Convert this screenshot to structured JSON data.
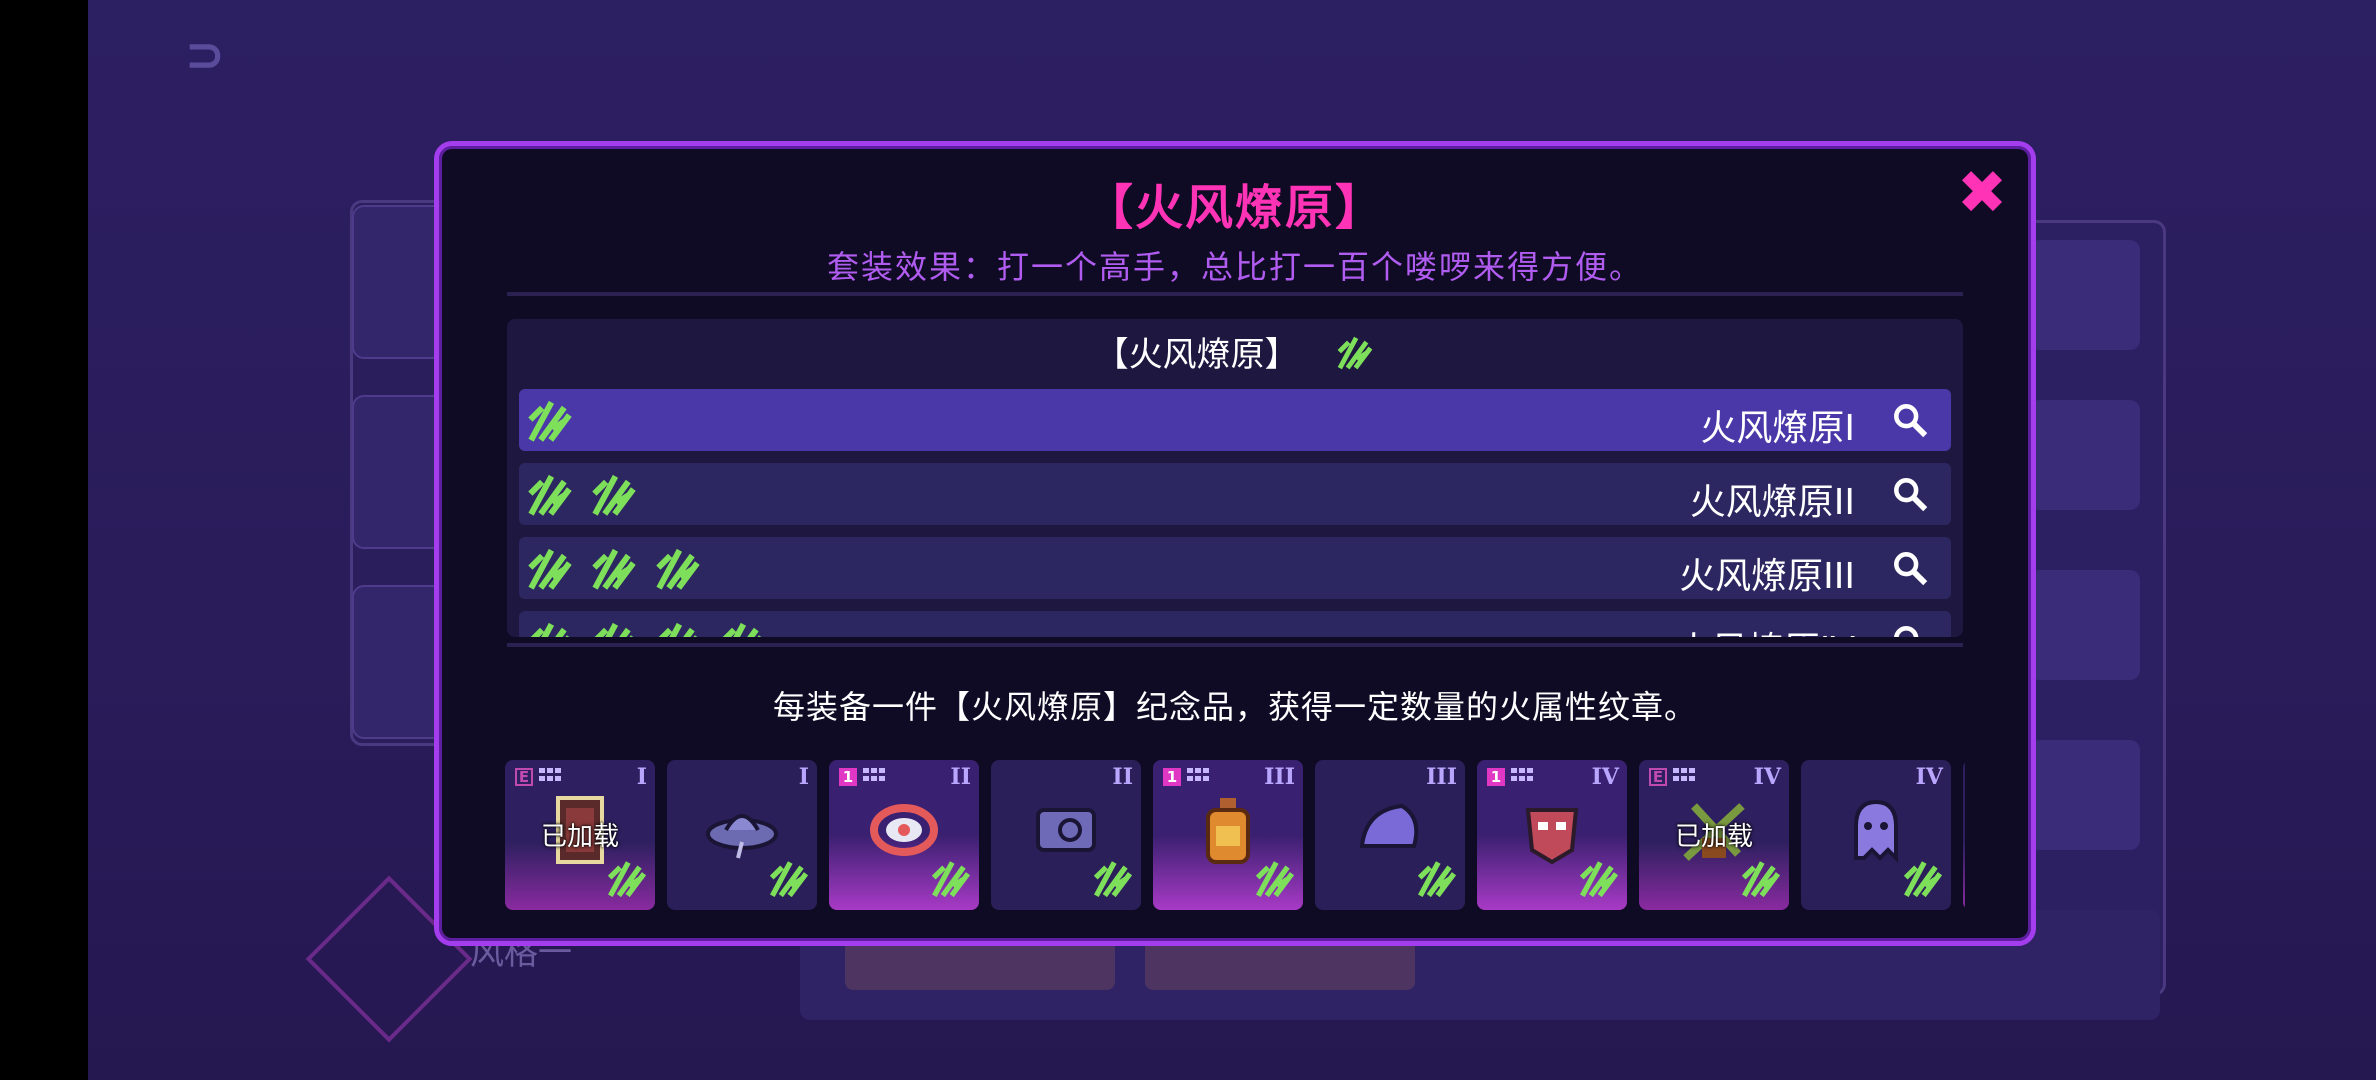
{
  "background": {
    "style_label": "风格一",
    "back_glyph": "⊃"
  },
  "modal": {
    "title": "【火风燎原】",
    "close_glyph": "✖",
    "set_effect": "套装效果：打一个高手，总比打一百个喽啰来得方便。",
    "list_header_title": "【火风燎原】",
    "tiers": [
      {
        "name": "火风燎原I",
        "icon_count": 1,
        "selected": true
      },
      {
        "name": "火风燎原II",
        "icon_count": 2,
        "selected": false
      },
      {
        "name": "火风燎原III",
        "icon_count": 3,
        "selected": false
      },
      {
        "name": "火风燎原IV",
        "icon_count": 4,
        "selected": false
      }
    ],
    "description": "每装备一件【火风燎原】纪念品，获得一定数量的火属性纹章。",
    "items": [
      {
        "tier": "I",
        "badge": "E",
        "badge_style": "outline",
        "loaded": "已加载",
        "art": "card-art",
        "glow": "glow"
      },
      {
        "tier": "I",
        "badge": "",
        "badge_style": "",
        "loaded": "",
        "art": "hat-art",
        "glow": ""
      },
      {
        "tier": "II",
        "badge": "1",
        "badge_style": "solid",
        "loaded": "",
        "art": "ring-art",
        "glow": "glow-strong"
      },
      {
        "tier": "II",
        "badge": "",
        "badge_style": "",
        "loaded": "",
        "art": "box-art",
        "glow": ""
      },
      {
        "tier": "III",
        "badge": "1",
        "badge_style": "solid",
        "loaded": "",
        "art": "potion-art",
        "glow": "glow-strong"
      },
      {
        "tier": "III",
        "badge": "",
        "badge_style": "",
        "loaded": "",
        "art": "shell-art",
        "glow": ""
      },
      {
        "tier": "IV",
        "badge": "1",
        "badge_style": "solid",
        "loaded": "",
        "art": "mask-art",
        "glow": "glow-strong"
      },
      {
        "tier": "IV",
        "badge": "E",
        "badge_style": "outline",
        "loaded": "已加载",
        "art": "bamboo-art",
        "glow": "glow"
      },
      {
        "tier": "IV",
        "badge": "",
        "badge_style": "",
        "loaded": "",
        "art": "ghost-art",
        "glow": ""
      }
    ]
  },
  "colors": {
    "title_pink": "#ff33b5",
    "effect_purple": "#b15cf0",
    "border_purple": "#a43dee",
    "set_icon_green": "#7ee05a",
    "selected_row": "#4a38a8"
  }
}
